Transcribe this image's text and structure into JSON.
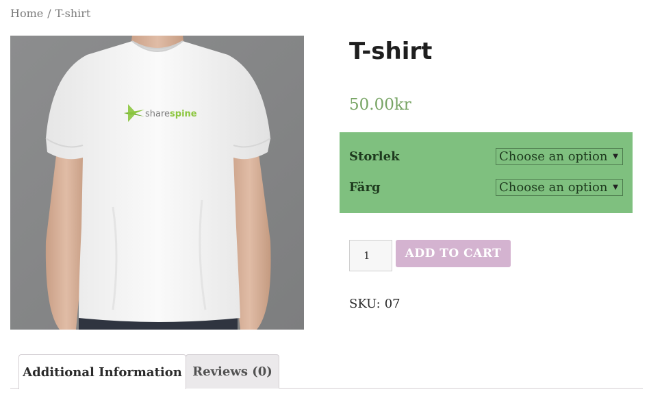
{
  "breadcrumb": {
    "home": "Home",
    "separator": "/",
    "current": "T-shirt"
  },
  "product": {
    "title": "T-shirt",
    "price": "50.00kr",
    "image_logo_text": "sharespine"
  },
  "variations": [
    {
      "label": "Storlek",
      "selected": "Choose an option"
    },
    {
      "label": "Färg",
      "selected": "Choose an option"
    }
  ],
  "cart": {
    "quantity": "1",
    "button_label": "ADD TO CART"
  },
  "meta": {
    "sku_label": "SKU:",
    "sku_value": "07"
  },
  "tabs": [
    {
      "label": "Additional Information",
      "active": true
    },
    {
      "label": "Reviews (0)",
      "active": false
    }
  ],
  "colors": {
    "price": "#77a464",
    "variations_bg": "#7fc07f",
    "button": "#d4b3d0"
  },
  "icons": {
    "select_caret": "caret-down-icon"
  }
}
